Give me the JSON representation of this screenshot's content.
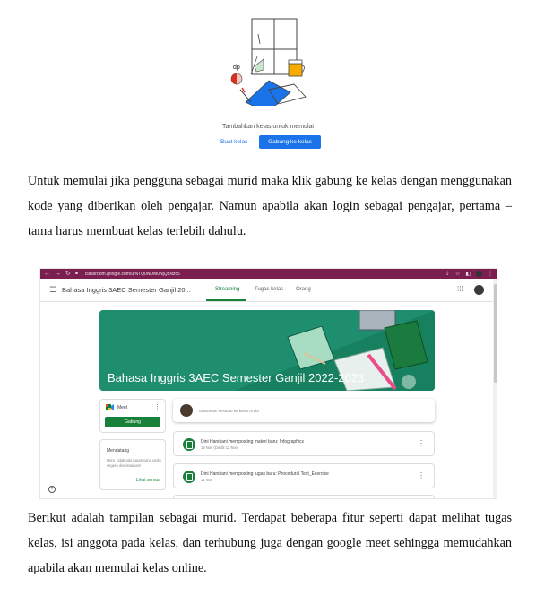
{
  "top_illustration": {
    "caption": "Tambahkan kelas untuk memulai",
    "create_label": "Buat kelas",
    "join_label": "Gabung ke kelas",
    "accent": "#1a73e8"
  },
  "paragraph1": "Untuk memulai jika pengguna sebagai murid maka klik gabung ke kelas dengan menggunakan kode yang diberikan oleh pengajar. Namun apabila akan login sebagai pengajar, pertama – tama harus membuat kelas terlebih dahulu.",
  "screenshot": {
    "browser_url": "classroom.google.com/u/NTQ0NDM0NjQ5Nzc5",
    "class_name": "Bahasa Inggris 3AEC Semester Ganjil 20...",
    "tabs": [
      "Streaming",
      "Tugas kelas",
      "Orang"
    ],
    "active_tab": "Streaming",
    "banner_title": "Bahasa Inggris 3AEC Semester Ganjil 2022-2023",
    "meet_label": "Meet",
    "meet_button": "Gabung",
    "upcoming_title": "Mendatang",
    "upcoming_text": "Hore, tidak ada tugas yang perlu segera diselesaikan!",
    "view_all": "Lihat semua",
    "announce_placeholder": "Umumkan sesuatu ke kelas Anda",
    "posts": [
      {
        "title": "Dini Handiani memposting materi baru: Infographics",
        "date": "12 Nov (Diedit 12 Nov)"
      },
      {
        "title": "Dini Handiani memposting tugas baru: Procedural Text_Exercise",
        "date": "11 Nov"
      }
    ],
    "colors": {
      "chrome": "#7a1f4f",
      "brand_green": "#188038",
      "banner": "#1e8e6e"
    }
  },
  "paragraph2": "Berikut adalah tampilan sebagai murid. Terdapat beberapa fitur seperti dapat melihat tugas kelas, isi anggota pada kelas, dan terhubung juga dengan google meet sehingga memudahkan apabila akan memulai kelas online."
}
